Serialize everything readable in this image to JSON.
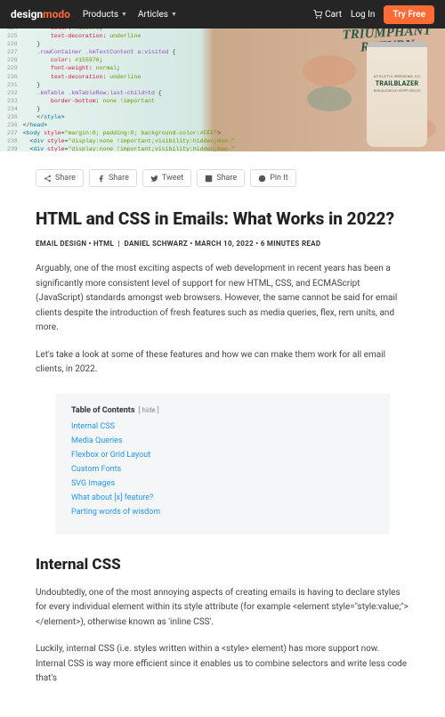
{
  "header": {
    "logo_a": "design",
    "logo_b": "modo",
    "nav": [
      {
        "label": "Products"
      },
      {
        "label": "Articles"
      }
    ],
    "cart": "Cart",
    "login": "Log In",
    "try": "Try Free"
  },
  "hero": {
    "banner_top": "TRIUMPHANT",
    "banner_bot": "RETURN",
    "can_brand": "ATHLETIC BREWING CO",
    "can_name": "TRAILBLAZER",
    "can_sub": "NON-ALCOHOLIC HOPPY HELLES"
  },
  "share": {
    "share": "Share",
    "fb": "Share",
    "tw": "Tweet",
    "li": "Share",
    "pin": "Pin It"
  },
  "article": {
    "title": "HTML and CSS in Emails: What Works in 2022?",
    "cat1": "EMAIL DESIGN",
    "cat2": "HTML",
    "author": "DANIEL SCHWARZ",
    "date": "MARCH 10, 2022",
    "read": "6 MINUTES READ",
    "p1": "Arguably, one of the most exciting aspects of web development in recent years has been a significantly more consistent level of support for new HTML, CSS, and ECMAScript (JavaScript) standards amongst web browsers. However, the same cannot be said for email clients despite the introduction of fresh features such as media queries, flex, rem units, and more.",
    "p2": "Let's take a look at some of these features and how we can make them work for all email clients, in 2022.",
    "h2": "Internal CSS",
    "p3": "Undoubtedly, one of the most annoying aspects of creating emails is having to declare styles for every individual element within its style attribute (for example <element style=\"style:value;\"></element>), otherwise known as 'inline CSS'.",
    "p4": "Luckily, internal CSS (i.e. styles written within a <style> element) has more support now. Internal CSS is way more efficient since it enables us to combine selectors and write less code that's"
  },
  "toc": {
    "title": "Table of Contents",
    "hide": "[ hide ]",
    "items": [
      "Internal CSS",
      "Media Queries",
      "Flexbox or Grid Layout",
      "Custom Fonts",
      "SVG Images",
      "What about [x] feature?",
      "Parting words of wisdom"
    ]
  }
}
